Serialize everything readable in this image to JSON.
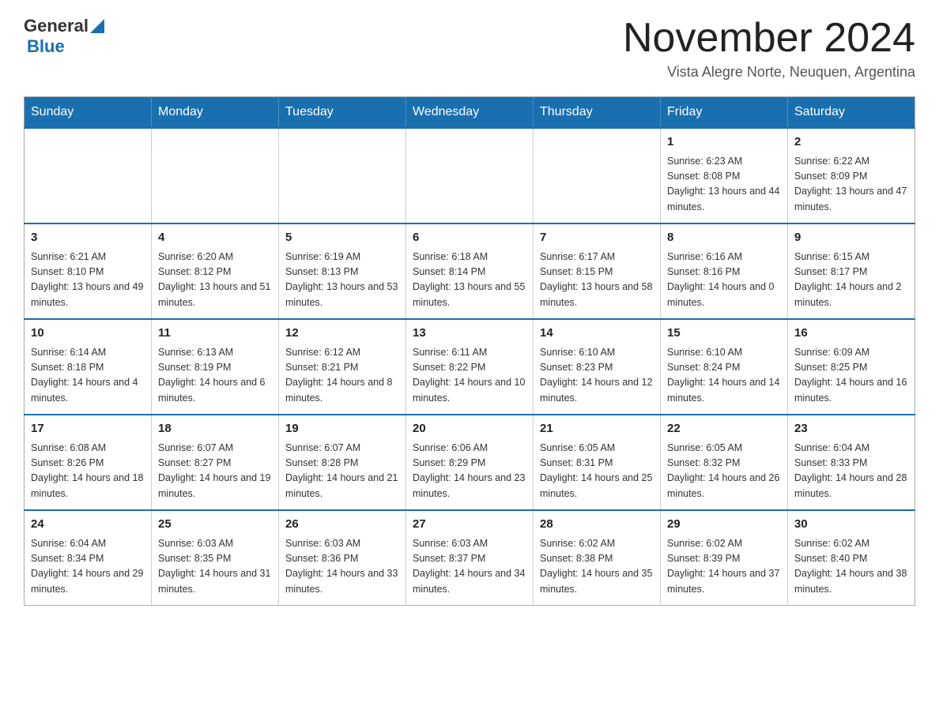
{
  "logo": {
    "general": "General",
    "blue": "Blue"
  },
  "title": "November 2024",
  "subtitle": "Vista Alegre Norte, Neuquen, Argentina",
  "days_of_week": [
    "Sunday",
    "Monday",
    "Tuesday",
    "Wednesday",
    "Thursday",
    "Friday",
    "Saturday"
  ],
  "weeks": [
    [
      {
        "day": "",
        "info": ""
      },
      {
        "day": "",
        "info": ""
      },
      {
        "day": "",
        "info": ""
      },
      {
        "day": "",
        "info": ""
      },
      {
        "day": "",
        "info": ""
      },
      {
        "day": "1",
        "info": "Sunrise: 6:23 AM\nSunset: 8:08 PM\nDaylight: 13 hours and 44 minutes."
      },
      {
        "day": "2",
        "info": "Sunrise: 6:22 AM\nSunset: 8:09 PM\nDaylight: 13 hours and 47 minutes."
      }
    ],
    [
      {
        "day": "3",
        "info": "Sunrise: 6:21 AM\nSunset: 8:10 PM\nDaylight: 13 hours and 49 minutes."
      },
      {
        "day": "4",
        "info": "Sunrise: 6:20 AM\nSunset: 8:12 PM\nDaylight: 13 hours and 51 minutes."
      },
      {
        "day": "5",
        "info": "Sunrise: 6:19 AM\nSunset: 8:13 PM\nDaylight: 13 hours and 53 minutes."
      },
      {
        "day": "6",
        "info": "Sunrise: 6:18 AM\nSunset: 8:14 PM\nDaylight: 13 hours and 55 minutes."
      },
      {
        "day": "7",
        "info": "Sunrise: 6:17 AM\nSunset: 8:15 PM\nDaylight: 13 hours and 58 minutes."
      },
      {
        "day": "8",
        "info": "Sunrise: 6:16 AM\nSunset: 8:16 PM\nDaylight: 14 hours and 0 minutes."
      },
      {
        "day": "9",
        "info": "Sunrise: 6:15 AM\nSunset: 8:17 PM\nDaylight: 14 hours and 2 minutes."
      }
    ],
    [
      {
        "day": "10",
        "info": "Sunrise: 6:14 AM\nSunset: 8:18 PM\nDaylight: 14 hours and 4 minutes."
      },
      {
        "day": "11",
        "info": "Sunrise: 6:13 AM\nSunset: 8:19 PM\nDaylight: 14 hours and 6 minutes."
      },
      {
        "day": "12",
        "info": "Sunrise: 6:12 AM\nSunset: 8:21 PM\nDaylight: 14 hours and 8 minutes."
      },
      {
        "day": "13",
        "info": "Sunrise: 6:11 AM\nSunset: 8:22 PM\nDaylight: 14 hours and 10 minutes."
      },
      {
        "day": "14",
        "info": "Sunrise: 6:10 AM\nSunset: 8:23 PM\nDaylight: 14 hours and 12 minutes."
      },
      {
        "day": "15",
        "info": "Sunrise: 6:10 AM\nSunset: 8:24 PM\nDaylight: 14 hours and 14 minutes."
      },
      {
        "day": "16",
        "info": "Sunrise: 6:09 AM\nSunset: 8:25 PM\nDaylight: 14 hours and 16 minutes."
      }
    ],
    [
      {
        "day": "17",
        "info": "Sunrise: 6:08 AM\nSunset: 8:26 PM\nDaylight: 14 hours and 18 minutes."
      },
      {
        "day": "18",
        "info": "Sunrise: 6:07 AM\nSunset: 8:27 PM\nDaylight: 14 hours and 19 minutes."
      },
      {
        "day": "19",
        "info": "Sunrise: 6:07 AM\nSunset: 8:28 PM\nDaylight: 14 hours and 21 minutes."
      },
      {
        "day": "20",
        "info": "Sunrise: 6:06 AM\nSunset: 8:29 PM\nDaylight: 14 hours and 23 minutes."
      },
      {
        "day": "21",
        "info": "Sunrise: 6:05 AM\nSunset: 8:31 PM\nDaylight: 14 hours and 25 minutes."
      },
      {
        "day": "22",
        "info": "Sunrise: 6:05 AM\nSunset: 8:32 PM\nDaylight: 14 hours and 26 minutes."
      },
      {
        "day": "23",
        "info": "Sunrise: 6:04 AM\nSunset: 8:33 PM\nDaylight: 14 hours and 28 minutes."
      }
    ],
    [
      {
        "day": "24",
        "info": "Sunrise: 6:04 AM\nSunset: 8:34 PM\nDaylight: 14 hours and 29 minutes."
      },
      {
        "day": "25",
        "info": "Sunrise: 6:03 AM\nSunset: 8:35 PM\nDaylight: 14 hours and 31 minutes."
      },
      {
        "day": "26",
        "info": "Sunrise: 6:03 AM\nSunset: 8:36 PM\nDaylight: 14 hours and 33 minutes."
      },
      {
        "day": "27",
        "info": "Sunrise: 6:03 AM\nSunset: 8:37 PM\nDaylight: 14 hours and 34 minutes."
      },
      {
        "day": "28",
        "info": "Sunrise: 6:02 AM\nSunset: 8:38 PM\nDaylight: 14 hours and 35 minutes."
      },
      {
        "day": "29",
        "info": "Sunrise: 6:02 AM\nSunset: 8:39 PM\nDaylight: 14 hours and 37 minutes."
      },
      {
        "day": "30",
        "info": "Sunrise: 6:02 AM\nSunset: 8:40 PM\nDaylight: 14 hours and 38 minutes."
      }
    ]
  ]
}
